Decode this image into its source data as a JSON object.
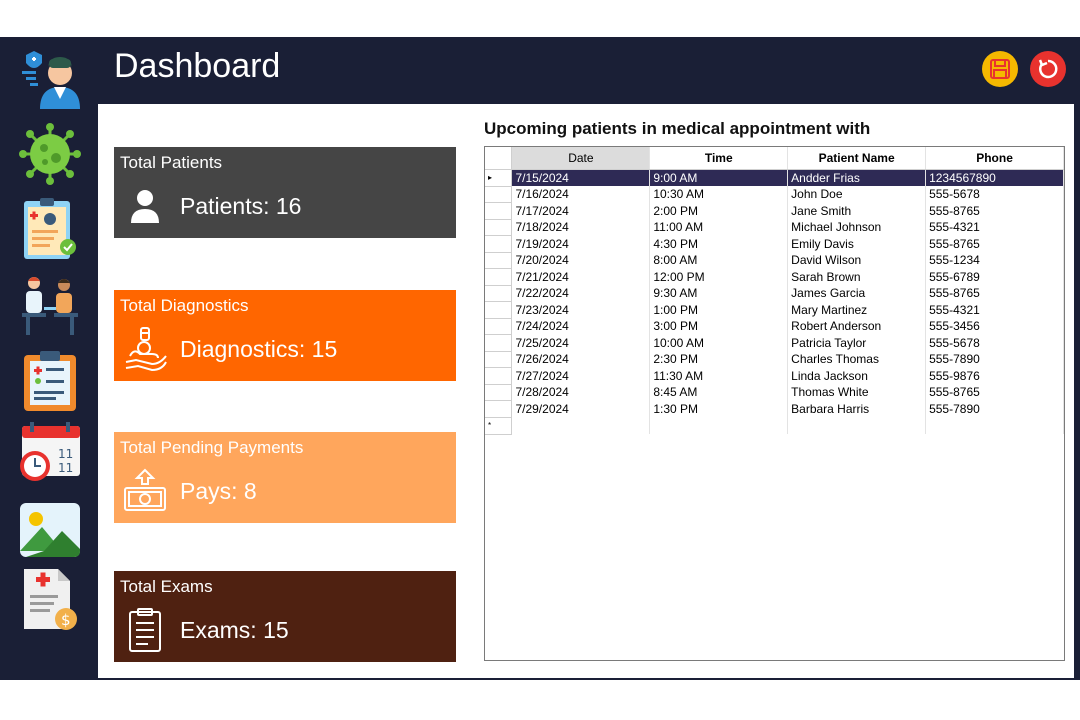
{
  "header": {
    "title": "Dashboard"
  },
  "sidebar": {
    "items": [
      {
        "icon": "doctor-icon"
      },
      {
        "icon": "virus-icon"
      },
      {
        "icon": "patient-record-icon"
      },
      {
        "icon": "consultation-icon"
      },
      {
        "icon": "clipboard-icon"
      },
      {
        "icon": "calendar-clock-icon"
      },
      {
        "icon": "image-icon"
      },
      {
        "icon": "invoice-icon"
      }
    ]
  },
  "cards": [
    {
      "title": "Total Patients",
      "value": "Patients: 16",
      "color": "#454545",
      "icon": "user-icon"
    },
    {
      "title": "Total Diagnostics",
      "value": "Diagnostics: 15",
      "color": "#ff6600",
      "icon": "diagnostic-icon"
    },
    {
      "title": "Total Pending Payments",
      "value": "Pays: 8",
      "color": "#ffa65c",
      "icon": "money-icon"
    },
    {
      "title": "Total Exams",
      "value": "Exams: 15",
      "color": "#4f2111",
      "icon": "clipboard-exam-icon"
    }
  ],
  "appointments": {
    "title": "Upcoming patients in medical appointment with",
    "columns": [
      "Date",
      "Time",
      "Patient Name",
      "Phone"
    ],
    "rows": [
      [
        "7/15/2024",
        "9:00 AM",
        "Andder Frias",
        "1234567890"
      ],
      [
        "7/16/2024",
        "10:30 AM",
        "John Doe",
        "555-5678"
      ],
      [
        "7/17/2024",
        "2:00 PM",
        "Jane Smith",
        "555-8765"
      ],
      [
        "7/18/2024",
        "11:00 AM",
        "Michael Johnson",
        "555-4321"
      ],
      [
        "7/19/2024",
        "4:30 PM",
        "Emily Davis",
        "555-8765"
      ],
      [
        "7/20/2024",
        "8:00 AM",
        "David Wilson",
        "555-1234"
      ],
      [
        "7/21/2024",
        "12:00 PM",
        "Sarah Brown",
        "555-6789"
      ],
      [
        "7/22/2024",
        "9:30 AM",
        "James Garcia",
        "555-8765"
      ],
      [
        "7/23/2024",
        "1:00 PM",
        "Mary Martinez",
        "555-4321"
      ],
      [
        "7/24/2024",
        "3:00 PM",
        "Robert Anderson",
        "555-3456"
      ],
      [
        "7/25/2024",
        "10:00 AM",
        "Patricia Taylor",
        "555-5678"
      ],
      [
        "7/26/2024",
        "2:30 PM",
        "Charles Thomas",
        "555-7890"
      ],
      [
        "7/27/2024",
        "11:30 AM",
        "Linda Jackson",
        "555-9876"
      ],
      [
        "7/28/2024",
        "8:45 AM",
        "Thomas White",
        "555-8765"
      ],
      [
        "7/29/2024",
        "1:30 PM",
        "Barbara Harris",
        "555-7890"
      ]
    ]
  },
  "colors": {
    "navy": "#1a1f36",
    "selected_row": "#2e2a55",
    "save_button": "#f5b800",
    "reset_button": "#e8322e"
  }
}
